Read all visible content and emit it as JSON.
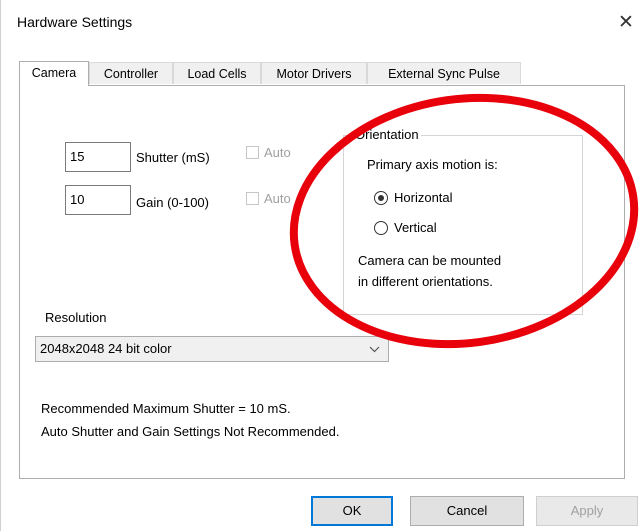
{
  "window": {
    "title": "Hardware Settings",
    "close_glyph": "✕"
  },
  "tabs": [
    {
      "label": "Camera",
      "active": true
    },
    {
      "label": "Controller",
      "active": false
    },
    {
      "label": "Load Cells",
      "active": false
    },
    {
      "label": "Motor Drivers",
      "active": false
    },
    {
      "label": "External Sync Pulse",
      "active": false
    }
  ],
  "camera": {
    "shutter": {
      "value": "15",
      "label": "Shutter (mS)",
      "auto_label": "Auto",
      "auto_checked": false
    },
    "gain": {
      "value": "10",
      "label": "Gain (0-100)",
      "auto_label": "Auto",
      "auto_checked": false
    },
    "orientation": {
      "legend": "Orientation",
      "prompt": "Primary axis motion is:",
      "options": [
        {
          "label": "Horizontal",
          "selected": true
        },
        {
          "label": "Vertical",
          "selected": false
        }
      ],
      "note_line1": "Camera can be mounted",
      "note_line2": "in different orientations."
    },
    "resolution": {
      "label": "Resolution",
      "selected": "2048x2048 24 bit color"
    },
    "recommendation_line1": "Recommended Maximum Shutter = 10 mS.",
    "recommendation_line2": "Auto Shutter and Gain Settings Not Recommended."
  },
  "buttons": {
    "ok": "OK",
    "cancel": "Cancel",
    "apply": "Apply"
  },
  "colors": {
    "annotation_circle": "#e8000b",
    "focus_border": "#0078d7"
  }
}
